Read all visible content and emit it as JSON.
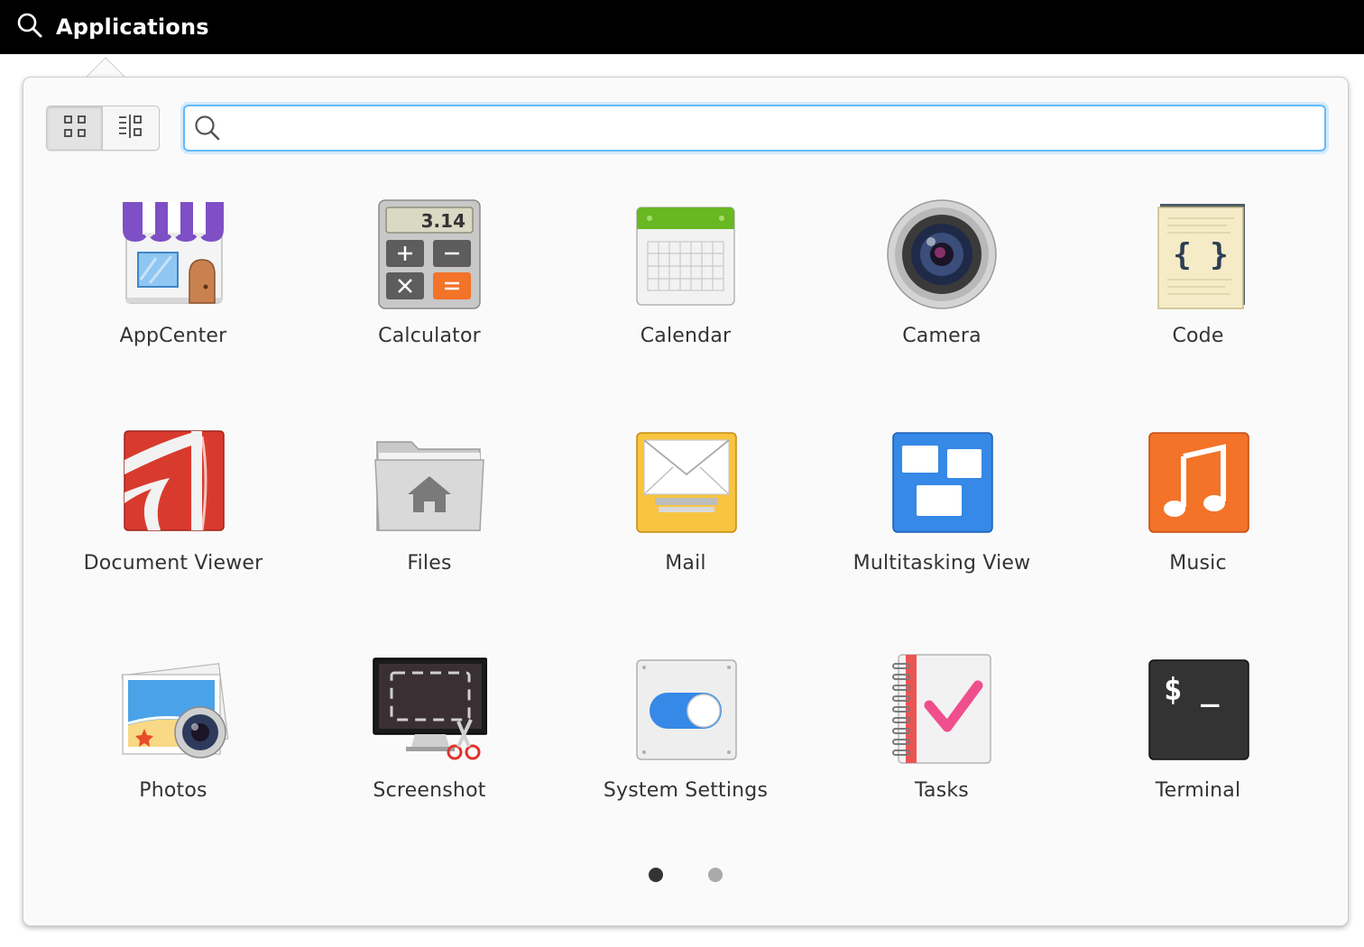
{
  "panel": {
    "title": "Applications",
    "icon": "search-icon"
  },
  "view_toggle": {
    "grid_icon": "grid-view-icon",
    "category_icon": "category-view-icon",
    "active": "grid"
  },
  "search": {
    "value": "",
    "placeholder": ""
  },
  "apps": [
    {
      "label": "AppCenter",
      "icon": "appcenter-icon"
    },
    {
      "label": "Calculator",
      "icon": "calculator-icon",
      "display": "3.14"
    },
    {
      "label": "Calendar",
      "icon": "calendar-icon"
    },
    {
      "label": "Camera",
      "icon": "camera-icon"
    },
    {
      "label": "Code",
      "icon": "code-icon",
      "glyph": "{ }"
    },
    {
      "label": "Document Viewer",
      "icon": "document-viewer-icon"
    },
    {
      "label": "Files",
      "icon": "files-icon"
    },
    {
      "label": "Mail",
      "icon": "mail-icon"
    },
    {
      "label": "Multitasking View",
      "icon": "multitasking-view-icon"
    },
    {
      "label": "Music",
      "icon": "music-icon"
    },
    {
      "label": "Photos",
      "icon": "photos-icon"
    },
    {
      "label": "Screenshot",
      "icon": "screenshot-icon"
    },
    {
      "label": "System Settings",
      "icon": "system-settings-icon"
    },
    {
      "label": "Tasks",
      "icon": "tasks-icon"
    },
    {
      "label": "Terminal",
      "icon": "terminal-icon",
      "prompt": "$ _"
    }
  ],
  "pager": {
    "pages": 2,
    "current": 1
  },
  "colors": {
    "panel_bg": "#000000",
    "popover_bg": "#fafafa",
    "accent": "#64baff",
    "label": "#333333"
  }
}
